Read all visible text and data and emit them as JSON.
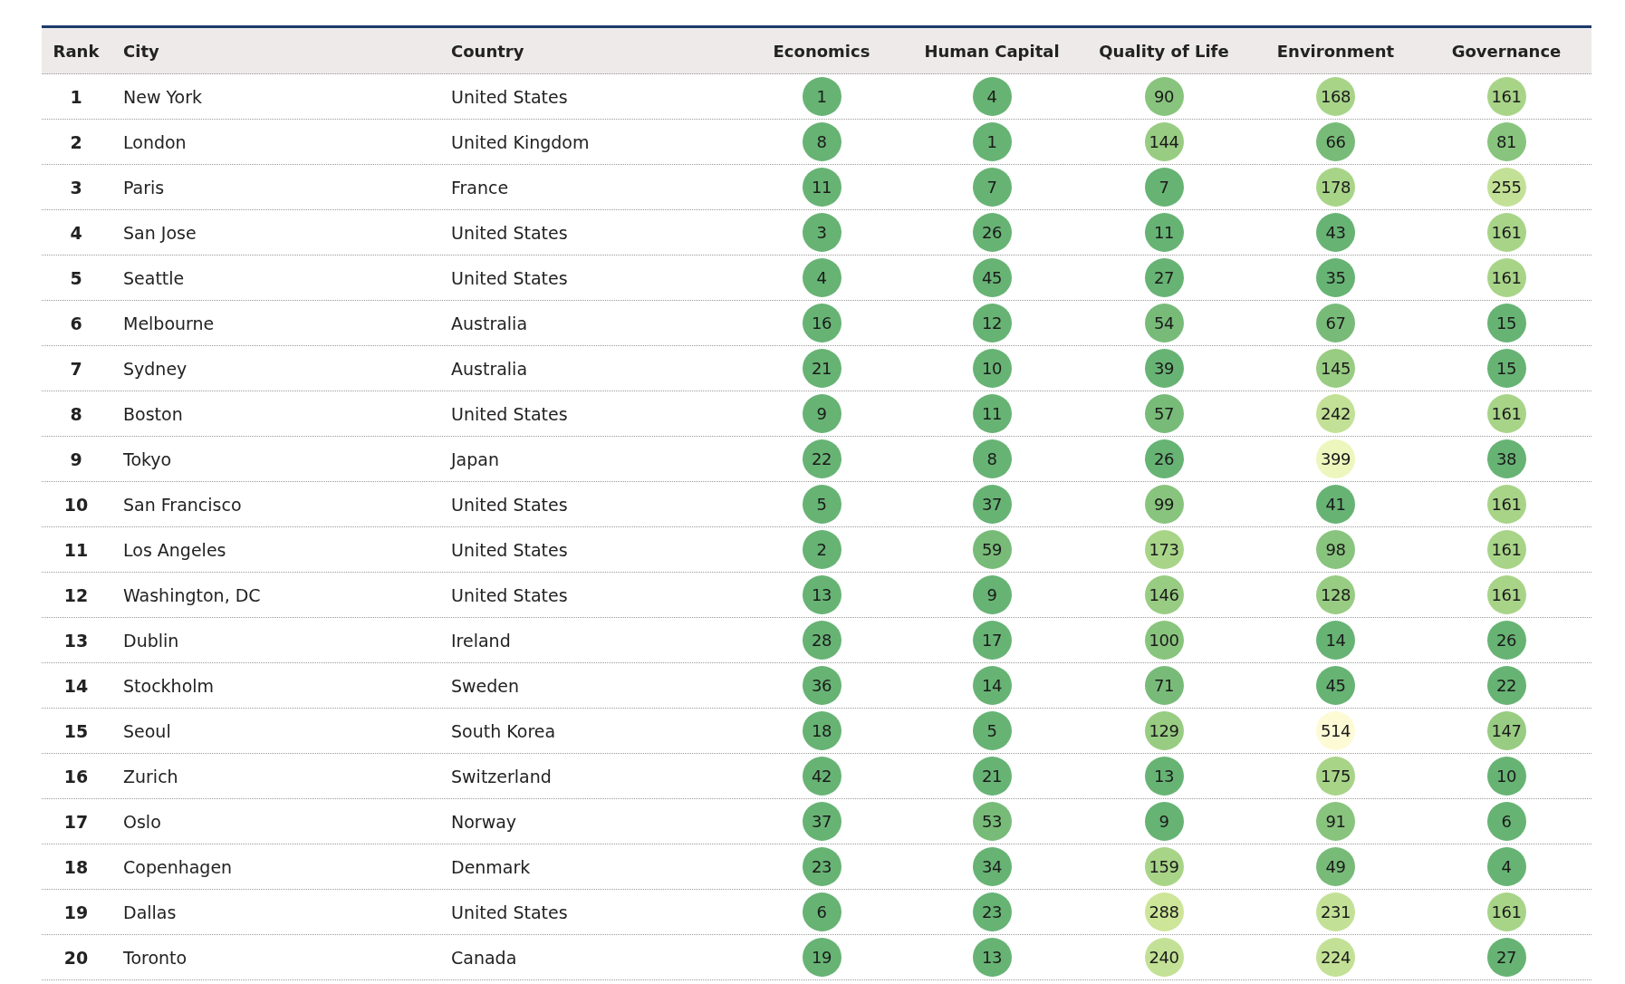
{
  "table": {
    "columns": [
      "Rank",
      "City",
      "Country",
      "Economics",
      "Human Capital",
      "Quality of Life",
      "Environment",
      "Governance"
    ],
    "rows": [
      {
        "rank": "1",
        "city": "New York",
        "country": "United States",
        "scores": [
          {
            "value": "1",
            "color": "#67b374"
          },
          {
            "value": "4",
            "color": "#67b374"
          },
          {
            "value": "90",
            "color": "#88c47d"
          },
          {
            "value": "168",
            "color": "#a8d488"
          },
          {
            "value": "161",
            "color": "#a8d488"
          }
        ]
      },
      {
        "rank": "2",
        "city": "London",
        "country": "United Kingdom",
        "scores": [
          {
            "value": "8",
            "color": "#67b374"
          },
          {
            "value": "1",
            "color": "#67b374"
          },
          {
            "value": "144",
            "color": "#98cc82"
          },
          {
            "value": "66",
            "color": "#78bb79"
          },
          {
            "value": "81",
            "color": "#88c47d"
          }
        ]
      },
      {
        "rank": "3",
        "city": "Paris",
        "country": "France",
        "scores": [
          {
            "value": "11",
            "color": "#67b374"
          },
          {
            "value": "7",
            "color": "#67b374"
          },
          {
            "value": "7",
            "color": "#67b374"
          },
          {
            "value": "178",
            "color": "#a8d488"
          },
          {
            "value": "255",
            "color": "#c3e196"
          }
        ]
      },
      {
        "rank": "4",
        "city": "San Jose",
        "country": "United States",
        "scores": [
          {
            "value": "3",
            "color": "#67b374"
          },
          {
            "value": "26",
            "color": "#67b374"
          },
          {
            "value": "11",
            "color": "#67b374"
          },
          {
            "value": "43",
            "color": "#67b374"
          },
          {
            "value": "161",
            "color": "#a8d488"
          }
        ]
      },
      {
        "rank": "5",
        "city": "Seattle",
        "country": "United States",
        "scores": [
          {
            "value": "4",
            "color": "#67b374"
          },
          {
            "value": "45",
            "color": "#67b374"
          },
          {
            "value": "27",
            "color": "#67b374"
          },
          {
            "value": "35",
            "color": "#67b374"
          },
          {
            "value": "161",
            "color": "#a8d488"
          }
        ]
      },
      {
        "rank": "6",
        "city": "Melbourne",
        "country": "Australia",
        "scores": [
          {
            "value": "16",
            "color": "#67b374"
          },
          {
            "value": "12",
            "color": "#67b374"
          },
          {
            "value": "54",
            "color": "#78bb79"
          },
          {
            "value": "67",
            "color": "#78bb79"
          },
          {
            "value": "15",
            "color": "#67b374"
          }
        ]
      },
      {
        "rank": "7",
        "city": "Sydney",
        "country": "Australia",
        "scores": [
          {
            "value": "21",
            "color": "#67b374"
          },
          {
            "value": "10",
            "color": "#67b374"
          },
          {
            "value": "39",
            "color": "#67b374"
          },
          {
            "value": "145",
            "color": "#98cc82"
          },
          {
            "value": "15",
            "color": "#67b374"
          }
        ]
      },
      {
        "rank": "8",
        "city": "Boston",
        "country": "United States",
        "scores": [
          {
            "value": "9",
            "color": "#67b374"
          },
          {
            "value": "11",
            "color": "#67b374"
          },
          {
            "value": "57",
            "color": "#78bb79"
          },
          {
            "value": "242",
            "color": "#c3e196"
          },
          {
            "value": "161",
            "color": "#a8d488"
          }
        ]
      },
      {
        "rank": "9",
        "city": "Tokyo",
        "country": "Japan",
        "scores": [
          {
            "value": "22",
            "color": "#67b374"
          },
          {
            "value": "8",
            "color": "#67b374"
          },
          {
            "value": "26",
            "color": "#67b374"
          },
          {
            "value": "399",
            "color": "#edf6bd"
          },
          {
            "value": "38",
            "color": "#67b374"
          }
        ]
      },
      {
        "rank": "10",
        "city": "San Francisco",
        "country": "United States",
        "scores": [
          {
            "value": "5",
            "color": "#67b374"
          },
          {
            "value": "37",
            "color": "#67b374"
          },
          {
            "value": "99",
            "color": "#88c47d"
          },
          {
            "value": "41",
            "color": "#67b374"
          },
          {
            "value": "161",
            "color": "#a8d488"
          }
        ]
      },
      {
        "rank": "11",
        "city": "Los Angeles",
        "country": "United States",
        "scores": [
          {
            "value": "2",
            "color": "#67b374"
          },
          {
            "value": "59",
            "color": "#78bb79"
          },
          {
            "value": "173",
            "color": "#a8d488"
          },
          {
            "value": "98",
            "color": "#88c47d"
          },
          {
            "value": "161",
            "color": "#a8d488"
          }
        ]
      },
      {
        "rank": "12",
        "city": "Washington, DC",
        "country": "United States",
        "scores": [
          {
            "value": "13",
            "color": "#67b374"
          },
          {
            "value": "9",
            "color": "#67b374"
          },
          {
            "value": "146",
            "color": "#98cc82"
          },
          {
            "value": "128",
            "color": "#98cc82"
          },
          {
            "value": "161",
            "color": "#a8d488"
          }
        ]
      },
      {
        "rank": "13",
        "city": "Dublin",
        "country": "Ireland",
        "scores": [
          {
            "value": "28",
            "color": "#67b374"
          },
          {
            "value": "17",
            "color": "#67b374"
          },
          {
            "value": "100",
            "color": "#88c47d"
          },
          {
            "value": "14",
            "color": "#67b374"
          },
          {
            "value": "26",
            "color": "#67b374"
          }
        ]
      },
      {
        "rank": "14",
        "city": "Stockholm",
        "country": "Sweden",
        "scores": [
          {
            "value": "36",
            "color": "#67b374"
          },
          {
            "value": "14",
            "color": "#67b374"
          },
          {
            "value": "71",
            "color": "#78bb79"
          },
          {
            "value": "45",
            "color": "#67b374"
          },
          {
            "value": "22",
            "color": "#67b374"
          }
        ]
      },
      {
        "rank": "15",
        "city": "Seoul",
        "country": "South Korea",
        "scores": [
          {
            "value": "18",
            "color": "#67b374"
          },
          {
            "value": "5",
            "color": "#67b374"
          },
          {
            "value": "129",
            "color": "#98cc82"
          },
          {
            "value": "514",
            "color": "#fdfbd5"
          },
          {
            "value": "147",
            "color": "#98cc82"
          }
        ]
      },
      {
        "rank": "16",
        "city": "Zurich",
        "country": "Switzerland",
        "scores": [
          {
            "value": "42",
            "color": "#67b374"
          },
          {
            "value": "21",
            "color": "#67b374"
          },
          {
            "value": "13",
            "color": "#67b374"
          },
          {
            "value": "175",
            "color": "#a8d488"
          },
          {
            "value": "10",
            "color": "#67b374"
          }
        ]
      },
      {
        "rank": "17",
        "city": "Oslo",
        "country": "Norway",
        "scores": [
          {
            "value": "37",
            "color": "#67b374"
          },
          {
            "value": "53",
            "color": "#78bb79"
          },
          {
            "value": "9",
            "color": "#67b374"
          },
          {
            "value": "91",
            "color": "#88c47d"
          },
          {
            "value": "6",
            "color": "#67b374"
          }
        ]
      },
      {
        "rank": "18",
        "city": "Copenhagen",
        "country": "Denmark",
        "scores": [
          {
            "value": "23",
            "color": "#67b374"
          },
          {
            "value": "34",
            "color": "#67b374"
          },
          {
            "value": "159",
            "color": "#a8d488"
          },
          {
            "value": "49",
            "color": "#78bb79"
          },
          {
            "value": "4",
            "color": "#67b374"
          }
        ]
      },
      {
        "rank": "19",
        "city": "Dallas",
        "country": "United States",
        "scores": [
          {
            "value": "6",
            "color": "#67b374"
          },
          {
            "value": "23",
            "color": "#67b374"
          },
          {
            "value": "288",
            "color": "#cde598"
          },
          {
            "value": "231",
            "color": "#c3e196"
          },
          {
            "value": "161",
            "color": "#a8d488"
          }
        ]
      },
      {
        "rank": "20",
        "city": "Toronto",
        "country": "Canada",
        "scores": [
          {
            "value": "19",
            "color": "#67b374"
          },
          {
            "value": "13",
            "color": "#67b374"
          },
          {
            "value": "240",
            "color": "#c3e196"
          },
          {
            "value": "224",
            "color": "#c3e196"
          },
          {
            "value": "27",
            "color": "#67b374"
          }
        ]
      }
    ]
  }
}
